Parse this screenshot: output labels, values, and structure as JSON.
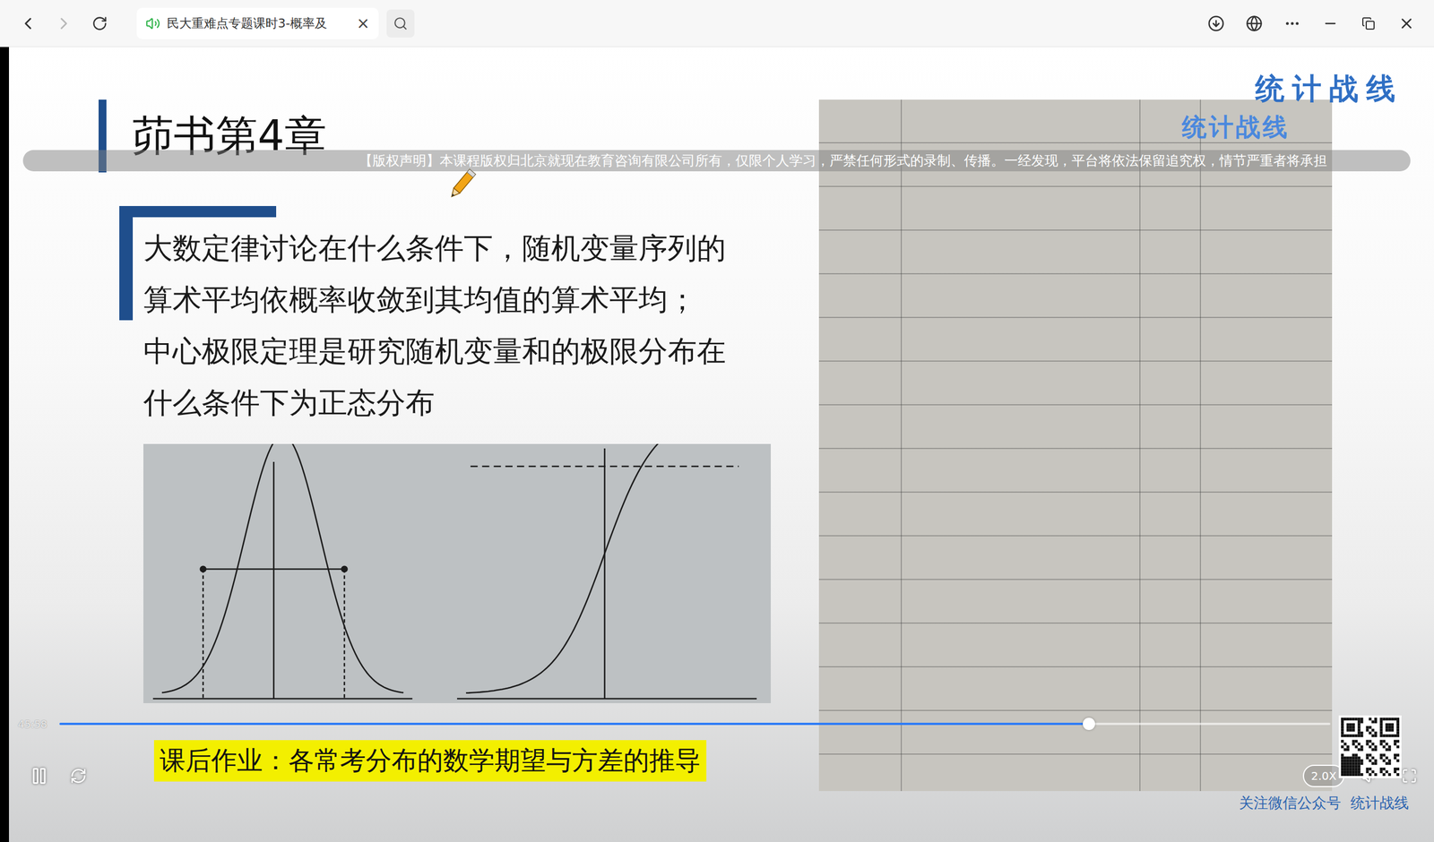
{
  "browser": {
    "tab": {
      "title": "民大重难点专题课时3-概率及",
      "playing_audio": true,
      "close": "×"
    }
  },
  "slide": {
    "title": "茆书第4章",
    "paragraphs": [
      "大数定律讨论在什么条件下，随机变量序列的算术平均依概率收敛到其均值的算术平均；",
      "中心极限定理是研究随机变量和的极限分布在什么条件下为正态分布"
    ],
    "homework": "课后作业：各常考分布的数学期望与方差的推导",
    "watermark": "统计战线",
    "table_watermark": "统计战线",
    "footer": "关注微信公众号  统计战线"
  },
  "player": {
    "copyright": "【版权声明】本课程版权归北京就现在教育咨询有限公司所有，仅限个人学习，严禁任何形式的录制、传播。一经发现，平台将依法保留追究权，情节严重者将承担",
    "time": "45:58",
    "progress": {
      "level": 0.81
    },
    "playing": true,
    "speed": "2.0X"
  }
}
